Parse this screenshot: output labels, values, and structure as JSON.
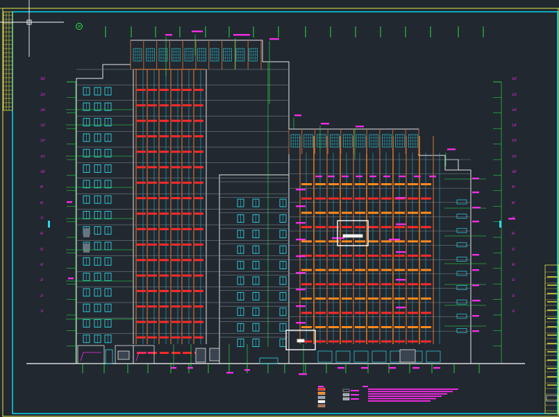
{
  "drawing": {
    "axis_marker": "30",
    "floor_labels": [
      "16F",
      "15F",
      "14F",
      "13F",
      "12F",
      "11F",
      "10F",
      "9F",
      "8F",
      "7F",
      "6F",
      "5F",
      "4F",
      "3F",
      "2F",
      "1F"
    ]
  },
  "legend": {
    "items": [
      "",
      "",
      "",
      "",
      ""
    ]
  },
  "colors": {
    "background": "#212830",
    "frame": "#00e5ff",
    "facade_line": "#e6e6e6",
    "window": "#30d8e8",
    "accent_red": "#ff2a2a",
    "accent_orange": "#ff8a1c",
    "label_magenta": "#ff2df0",
    "leader_green": "#2ef04a",
    "grille_brown": "#b0683a",
    "border_yellow": "#e8e84a"
  },
  "icons": [
    "crosshair-cursor-icon",
    "axis-marker-icon"
  ]
}
